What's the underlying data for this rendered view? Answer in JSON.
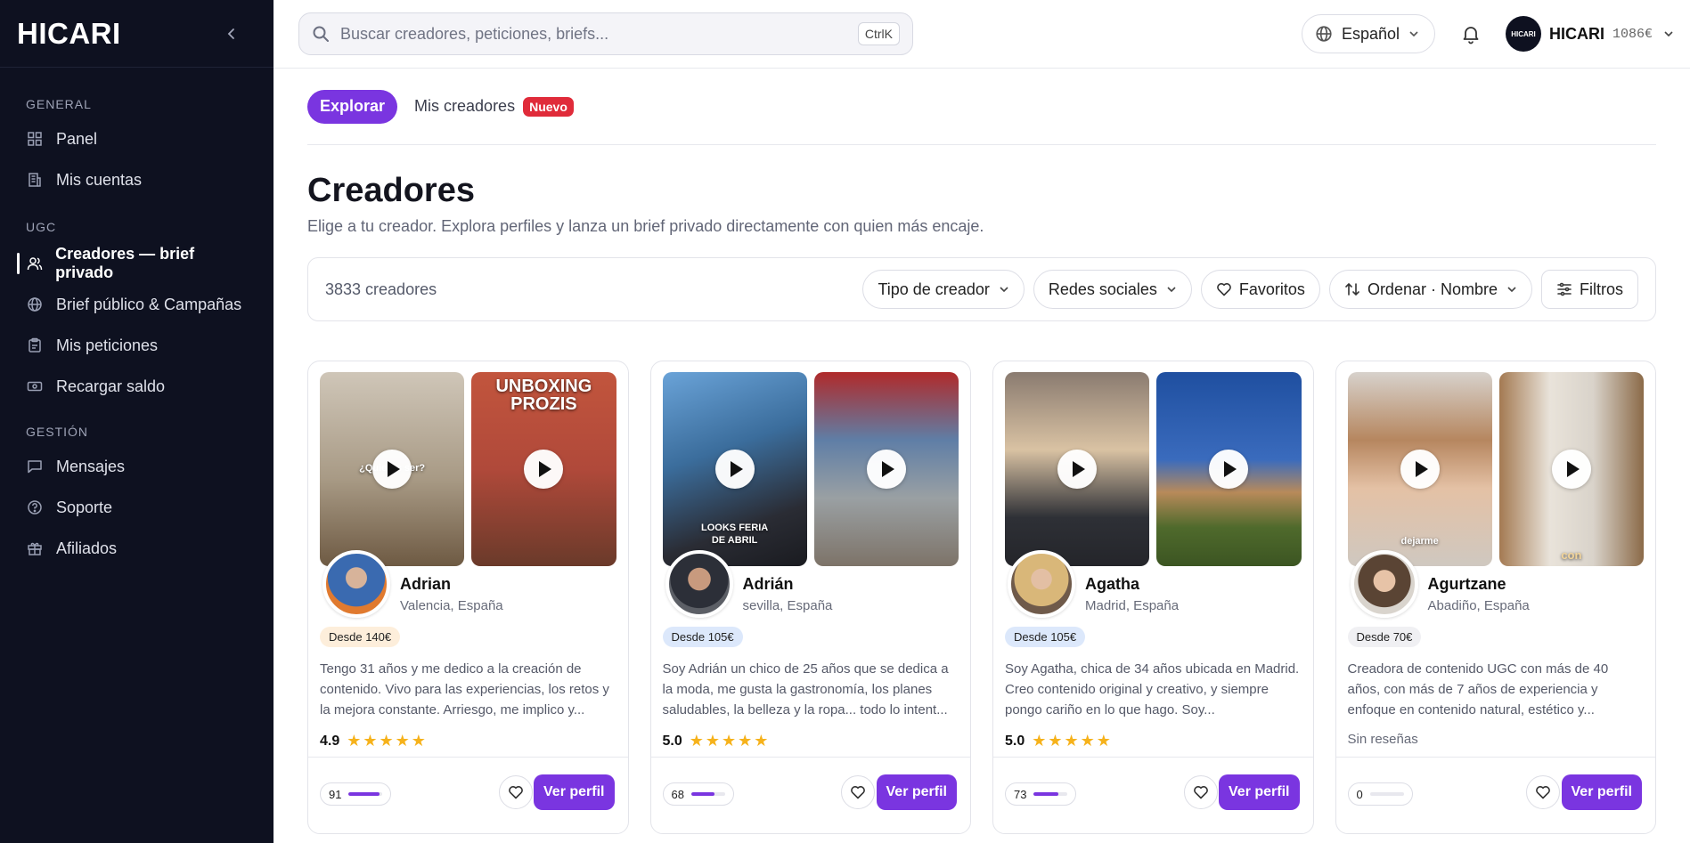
{
  "sidebar": {
    "logo": "HICARI",
    "sections": [
      {
        "title": "GENERAL",
        "items": [
          {
            "label": "Panel",
            "icon": "grid-icon"
          },
          {
            "label": "Mis cuentas",
            "icon": "building-icon"
          }
        ]
      },
      {
        "title": "UGC",
        "items": [
          {
            "label": "Creadores — brief privado",
            "icon": "users-icon",
            "active": true
          },
          {
            "label": "Brief público & Campañas",
            "icon": "globe-icon"
          },
          {
            "label": "Mis peticiones",
            "icon": "clipboard-icon"
          },
          {
            "label": "Recargar saldo",
            "icon": "banknote-icon"
          }
        ]
      },
      {
        "title": "GESTIÓN",
        "items": [
          {
            "label": "Mensajes",
            "icon": "message-icon"
          },
          {
            "label": "Soporte",
            "icon": "help-icon"
          },
          {
            "label": "Afiliados",
            "icon": "gift-icon"
          }
        ]
      }
    ]
  },
  "topbar": {
    "search_placeholder": "Buscar creadores, peticiones, briefs...",
    "shortcut": "CtrlK",
    "language": "Español",
    "user": {
      "avatar_text": "HICARI",
      "name": "HICARI",
      "balance": "1086€"
    }
  },
  "tabs": {
    "explore": "Explorar",
    "mine": "Mis creadores",
    "mine_badge": "Nuevo"
  },
  "header": {
    "title": "Creadores",
    "subtitle": "Elige a tu creador. Explora perfiles y lanza un brief privado directamente con quien más encaje."
  },
  "toolbar": {
    "count": "3833 creadores",
    "type": "Tipo de creador",
    "social": "Redes sociales",
    "favorites": "Favoritos",
    "sort": "Ordenar · Nombre",
    "filters": "Filtros"
  },
  "cards": [
    {
      "name": "Adrian",
      "location": "Valencia, España",
      "price": "Desde 140€",
      "price_bg": "#fdeedb",
      "desc": "Tengo 31 años y me dedico a la creación de contenido. Vivo para las experiencias, los retos y la mejora constante. Arriesgo, me implico y...",
      "rating": "4.9",
      "stars": "★★★★★",
      "stat": "91",
      "stat_pct": 0.91,
      "video1_text": "¿Quieres ser?",
      "video2_text": "UNBOXING PROZIS",
      "cta": "Ver perfil"
    },
    {
      "name": "Adrián",
      "location": "sevilla, España",
      "price": "Desde 105€",
      "price_bg": "#dce8fb",
      "desc": "Soy Adrián un chico de 25 años que se dedica a la moda, me gusta la gastronomía, los planes saludables, la belleza y la ropa... todo lo intent...",
      "rating": "5.0",
      "stars": "★★★★★",
      "stat": "68",
      "stat_pct": 0.68,
      "video1_text": "LOOKS FERIA DE ABRIL",
      "video2_text": "",
      "cta": "Ver perfil"
    },
    {
      "name": "Agatha",
      "location": "Madrid, España",
      "price": "Desde 105€",
      "price_bg": "#dce8fb",
      "desc": "Soy Agatha, chica de 34 años ubicada en Madrid. Creo contenido original y creativo, y siempre pongo cariño en lo que hago. Soy...",
      "rating": "5.0",
      "stars": "★★★★★",
      "stat": "73",
      "stat_pct": 0.73,
      "video1_text": "",
      "video2_text": "",
      "cta": "Ver perfil"
    },
    {
      "name": "Agurtzane",
      "location": "Abadiño, España",
      "price": "Desde 70€",
      "price_bg": "#f0f0f3",
      "desc": "Creadora de contenido UGC con más de 40 años, con más de 7 años de experiencia y enfoque en contenido natural, estético y...",
      "rating": "",
      "no_reviews": "Sin reseñas",
      "stars": "",
      "stat": "0",
      "stat_pct": 0,
      "video1_text": "dejarme",
      "video2_text": "con",
      "cta": "Ver perfil"
    }
  ]
}
